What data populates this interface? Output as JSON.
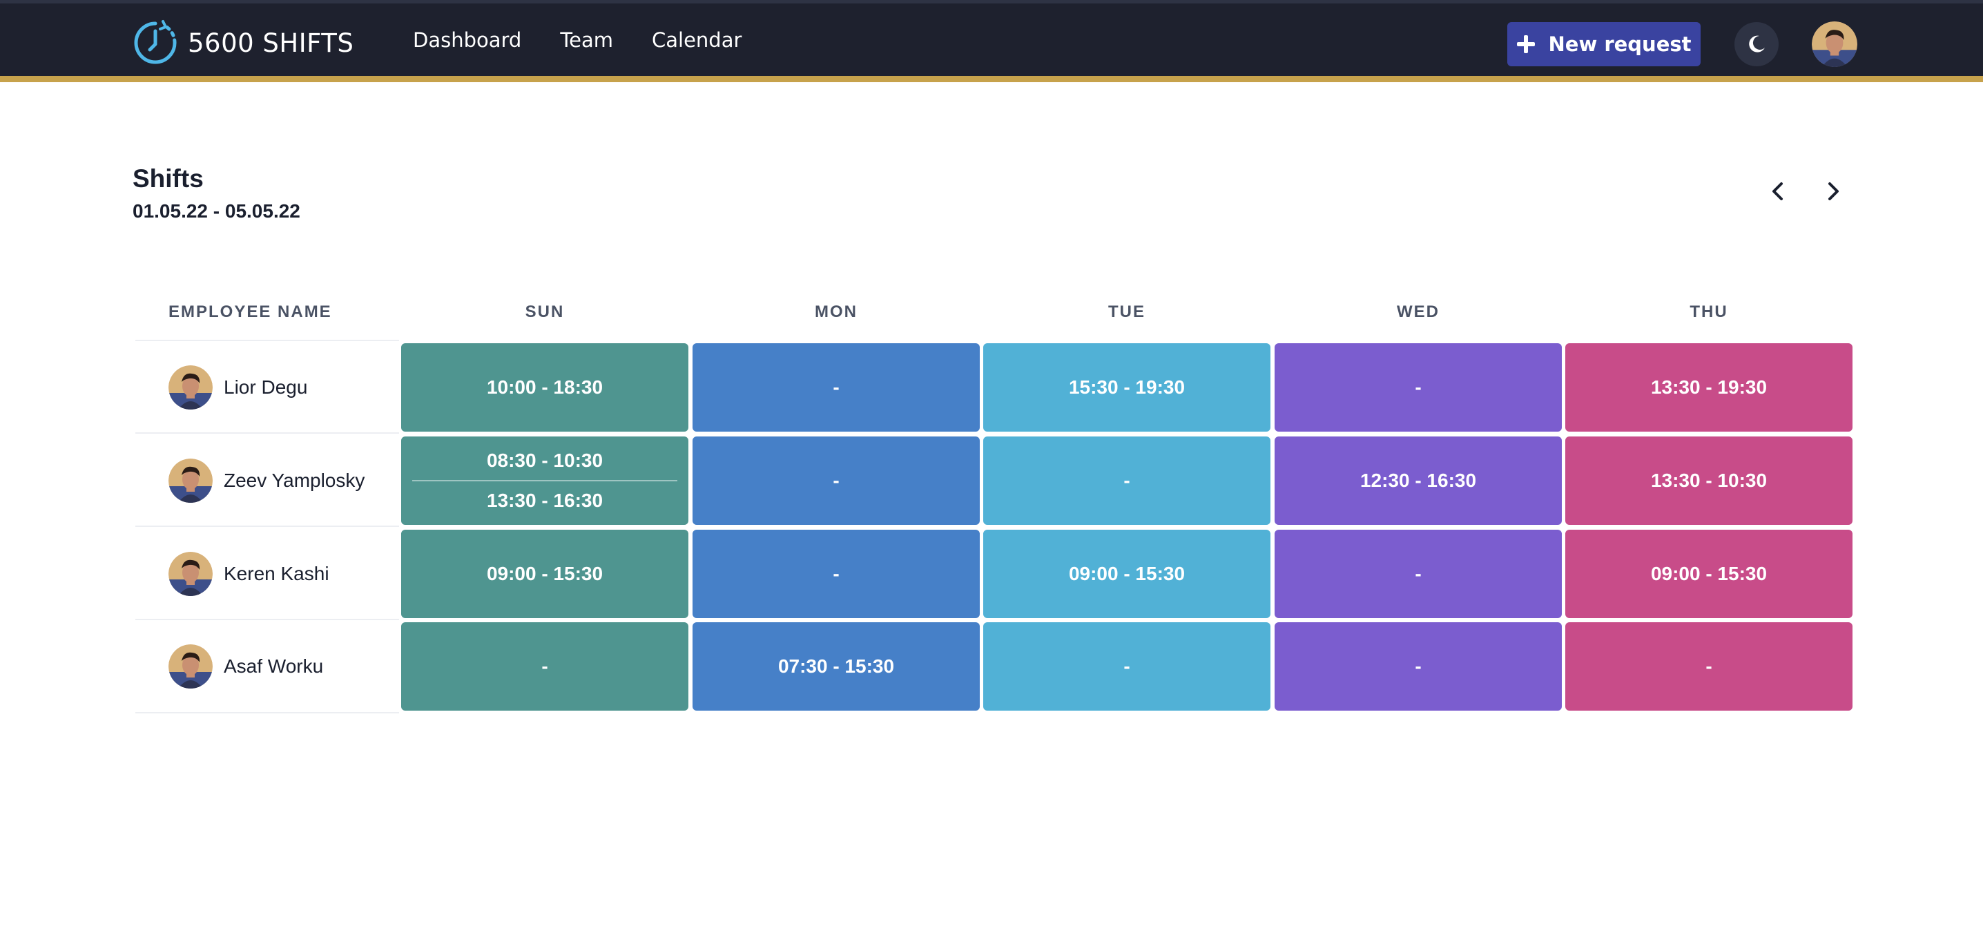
{
  "header": {
    "app_name": "5600 SHIFTS",
    "nav": [
      "Dashboard",
      "Team",
      "Calendar"
    ],
    "new_request_label": "New request",
    "icons": {
      "logo": "clock-refresh-icon",
      "plus": "plus-icon",
      "theme": "moon-icon",
      "avatar": "user-avatar"
    }
  },
  "page": {
    "title": "Shifts",
    "date_range": "01.05.22 - 05.05.22",
    "prev_icon": "chevron-left-icon",
    "next_icon": "chevron-right-icon"
  },
  "table": {
    "employee_header": "EMPLOYEE NAME",
    "days": [
      "SUN",
      "MON",
      "TUE",
      "WED",
      "THU"
    ],
    "day_colors": [
      "#4f9590",
      "#4680c8",
      "#51b1d6",
      "#7b5dcf",
      "#c84c89"
    ],
    "rows": [
      {
        "name": "Lior Degu",
        "shifts": [
          [
            "10:00 - 18:30"
          ],
          [
            "-"
          ],
          [
            "15:30 - 19:30"
          ],
          [
            "-"
          ],
          [
            "13:30 - 19:30"
          ]
        ]
      },
      {
        "name": "Zeev Yamplosky",
        "shifts": [
          [
            "08:30 - 10:30",
            "13:30 - 16:30"
          ],
          [
            "-"
          ],
          [
            "-"
          ],
          [
            "12:30 - 16:30"
          ],
          [
            "13:30 - 10:30"
          ]
        ]
      },
      {
        "name": "Keren Kashi",
        "shifts": [
          [
            "09:00 - 15:30"
          ],
          [
            "-"
          ],
          [
            "09:00 - 15:30"
          ],
          [
            "-"
          ],
          [
            "09:00 - 15:30"
          ]
        ]
      },
      {
        "name": "Asaf Worku",
        "shifts": [
          [
            "-"
          ],
          [
            "07:30 - 15:30"
          ],
          [
            "-"
          ],
          [
            "-"
          ],
          [
            "-"
          ]
        ]
      }
    ]
  },
  "colors": {
    "topbar": "#1e212e",
    "accent_line": "#c7a24c",
    "button": "#3a43a0"
  }
}
